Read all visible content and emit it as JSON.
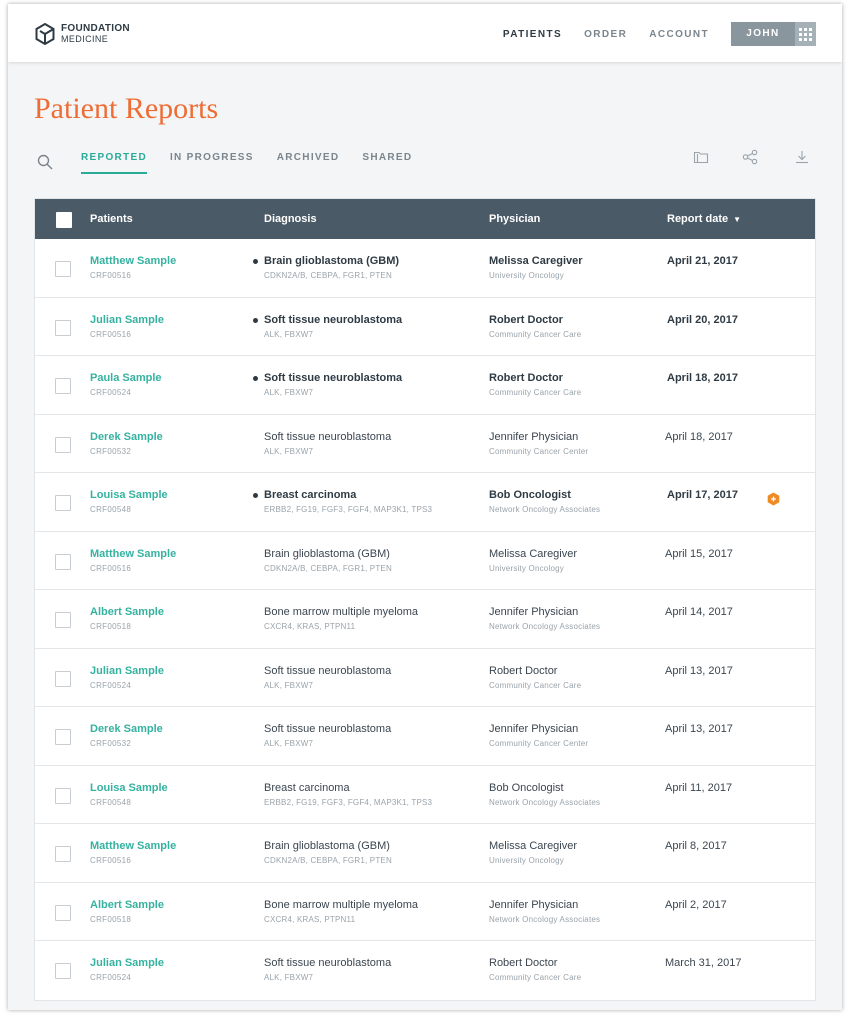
{
  "brand": {
    "line1": "FOUNDATION",
    "line2": "MEDICINE"
  },
  "nav": {
    "links": [
      {
        "label": "PATIENTS",
        "active": true
      },
      {
        "label": "ORDER",
        "active": false
      },
      {
        "label": "ACCOUNT",
        "active": false
      }
    ],
    "user": "JOHN S."
  },
  "page": {
    "title": "Patient Reports"
  },
  "tabs": [
    {
      "label": "REPORTED",
      "active": true
    },
    {
      "label": "IN PROGRESS",
      "active": false
    },
    {
      "label": "ARCHIVED",
      "active": false
    },
    {
      "label": "SHARED",
      "active": false
    }
  ],
  "toolbar": {
    "icons": [
      "folder-icon",
      "share-icon",
      "download-icon"
    ]
  },
  "table": {
    "columns": {
      "patients": "Patients",
      "diagnosis": "Diagnosis",
      "physician": "Physician",
      "report_date": "Report date"
    },
    "sort_indicator": "▼",
    "rows": [
      {
        "name": "Matthew Sample",
        "id": "CRF00516",
        "diagnosis": "Brain glioblastoma (GBM)",
        "genes": "CDKN2A/B, CEBPA, FGR1, PTEN",
        "physician": "Melissa Caregiver",
        "institution": "University Oncology",
        "date": "April 21, 2017",
        "unread": true,
        "flag": false
      },
      {
        "name": "Julian Sample",
        "id": "CRF00516",
        "diagnosis": "Soft tissue neuroblastoma",
        "genes": "ALK, FBXW7",
        "physician": "Robert Doctor",
        "institution": "Community Cancer Care",
        "date": "April 20, 2017",
        "unread": true,
        "flag": false
      },
      {
        "name": "Paula Sample",
        "id": "CRF00524",
        "diagnosis": "Soft tissue neuroblastoma",
        "genes": "ALK, FBXW7",
        "physician": "Robert Doctor",
        "institution": "Community Cancer Care",
        "date": "April 18, 2017",
        "unread": true,
        "flag": false
      },
      {
        "name": "Derek Sample",
        "id": "CRF00532",
        "diagnosis": "Soft tissue neuroblastoma",
        "genes": "ALK, FBXW7",
        "physician": "Jennifer Physician",
        "institution": "Community Cancer Center",
        "date": "April 18, 2017",
        "unread": false,
        "flag": false
      },
      {
        "name": "Louisa Sample",
        "id": "CRF00548",
        "diagnosis": "Breast carcinoma",
        "genes": "ERBB2, FG19, FGF3, FGF4, MAP3K1, TPS3",
        "physician": "Bob Oncologist",
        "institution": "Network Oncology Associates",
        "date": "April 17, 2017",
        "unread": true,
        "flag": true
      },
      {
        "name": "Matthew Sample",
        "id": "CRF00516",
        "diagnosis": "Brain glioblastoma (GBM)",
        "genes": "CDKN2A/B, CEBPA, FGR1, PTEN",
        "physician": "Melissa Caregiver",
        "institution": "University Oncology",
        "date": "April 15, 2017",
        "unread": false,
        "flag": false
      },
      {
        "name": "Albert Sample",
        "id": "CRF00518",
        "diagnosis": "Bone marrow multiple myeloma",
        "genes": "CXCR4, KRAS, PTPN11",
        "physician": "Jennifer Physician",
        "institution": "Network Oncology Associates",
        "date": "April 14, 2017",
        "unread": false,
        "flag": false
      },
      {
        "name": "Julian Sample",
        "id": "CRF00524",
        "diagnosis": "Soft tissue neuroblastoma",
        "genes": "ALK, FBXW7",
        "physician": "Robert Doctor",
        "institution": "Community Cancer Care",
        "date": "April 13, 2017",
        "unread": false,
        "flag": false
      },
      {
        "name": "Derek Sample",
        "id": "CRF00532",
        "diagnosis": "Soft tissue neuroblastoma",
        "genes": "ALK, FBXW7",
        "physician": "Jennifer Physician",
        "institution": "Community Cancer Center",
        "date": "April 13, 2017",
        "unread": false,
        "flag": false
      },
      {
        "name": "Louisa Sample",
        "id": "CRF00548",
        "diagnosis": "Breast carcinoma",
        "genes": "ERBB2, FG19, FGF3, FGF4, MAP3K1, TPS3",
        "physician": "Bob Oncologist",
        "institution": "Network Oncology Associates",
        "date": "April 11, 2017",
        "unread": false,
        "flag": false
      },
      {
        "name": "Matthew Sample",
        "id": "CRF00516",
        "diagnosis": "Brain glioblastoma (GBM)",
        "genes": "CDKN2A/B, CEBPA, FGR1, PTEN",
        "physician": "Melissa Caregiver",
        "institution": "University Oncology",
        "date": "April 8, 2017",
        "unread": false,
        "flag": false
      },
      {
        "name": "Albert Sample",
        "id": "CRF00518",
        "diagnosis": "Bone marrow multiple myeloma",
        "genes": "CXCR4, KRAS, PTPN11",
        "physician": "Jennifer Physician",
        "institution": "Network Oncology Associates",
        "date": "April 2, 2017",
        "unread": false,
        "flag": false
      },
      {
        "name": "Julian Sample",
        "id": "CRF00524",
        "diagnosis": "Soft tissue neuroblastoma",
        "genes": "ALK, FBXW7",
        "physician": "Robert Doctor",
        "institution": "Community Cancer Care",
        "date": "March 31, 2017",
        "unread": false,
        "flag": false
      }
    ]
  },
  "colors": {
    "accent_teal": "#35b2a0",
    "title_orange": "#ee6d35",
    "header_slate": "#4b5a67",
    "flag_orange": "#f08a24"
  }
}
